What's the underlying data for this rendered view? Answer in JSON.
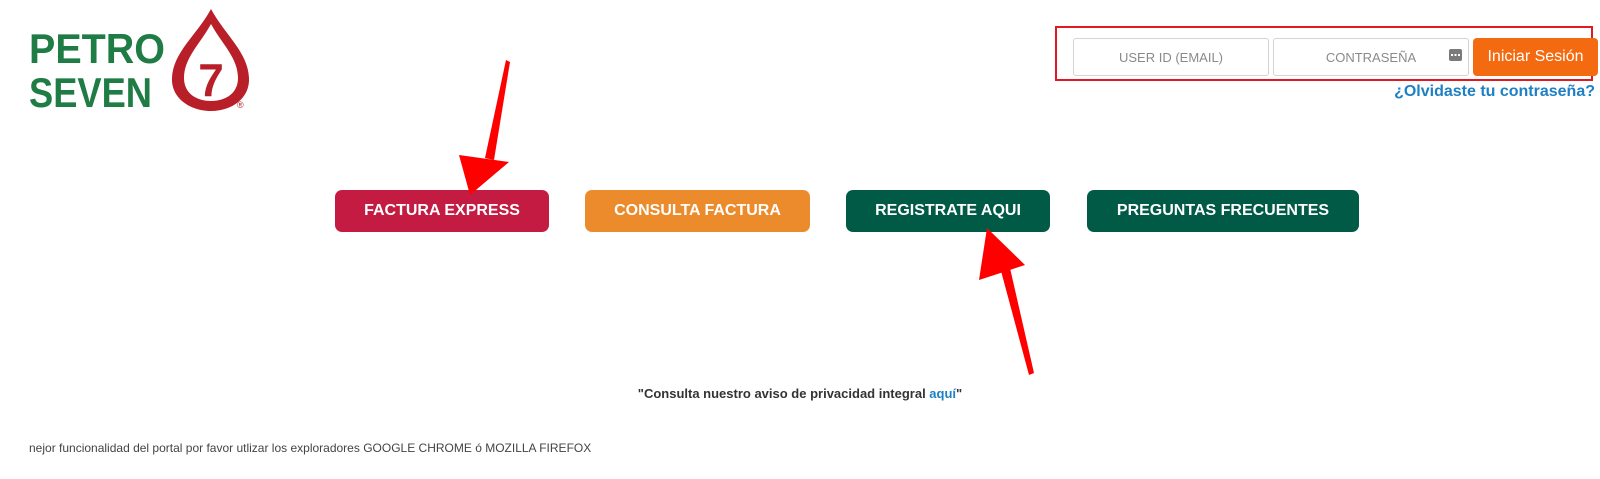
{
  "logo": {
    "line1": "PETRO",
    "line2": "SEVEN",
    "emblem_text": "7",
    "registered_mark": "®",
    "colors": {
      "green": "#1f7c45",
      "red": "#b81f28"
    }
  },
  "login": {
    "user_placeholder": "USER ID (EMAIL)",
    "password_placeholder": "CONTRASEÑA",
    "submit_label": "Iniciar Sesión",
    "forgot_link": "¿Olvidaste tu contraseña?",
    "highlight_color": "#e11a22"
  },
  "actions": {
    "factura_express": "FACTURA EXPRESS",
    "consulta_factura": "CONSULTA FACTURA",
    "registrate": "REGISTRATE AQUI",
    "preguntas": "PREGUNTAS FRECUENTES"
  },
  "privacy": {
    "text_before": "\"Consulta nuestro aviso de privacidad integral ",
    "link": "aquí",
    "text_after": "\""
  },
  "footer": {
    "note": "nejor funcionalidad del portal por favor utlizar los exploradores GOOGLE CHROME ó MOZILLA FIREFOX"
  },
  "annotations": {
    "arrow_color": "#ff0000",
    "arrow_icons": [
      "arrow-to-factura-express",
      "arrow-to-registrate"
    ]
  }
}
